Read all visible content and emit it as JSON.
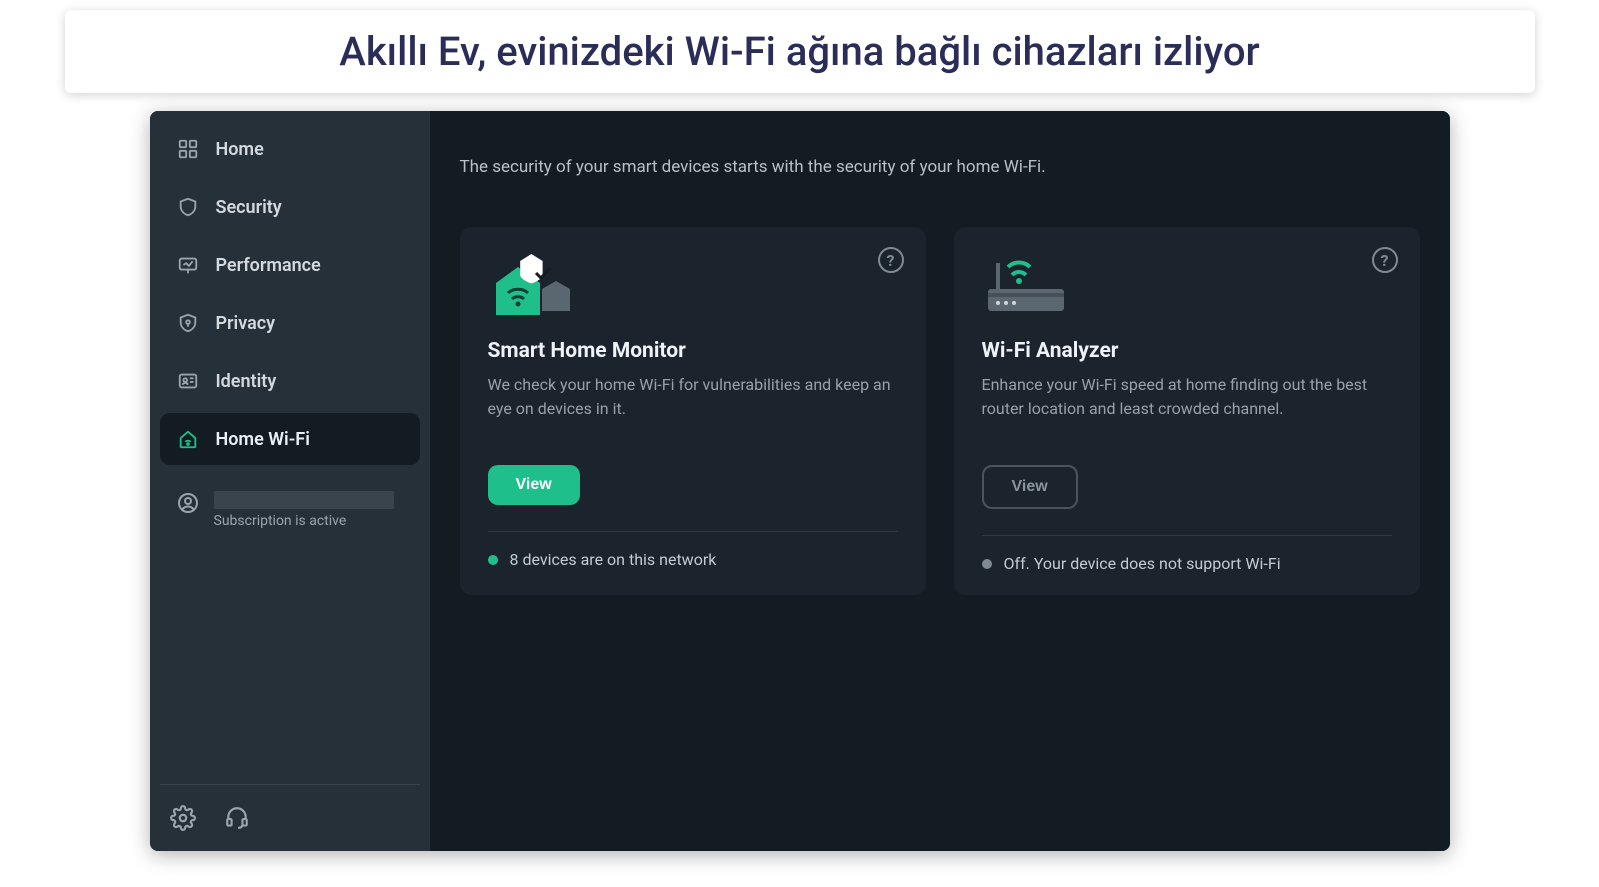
{
  "caption": "Akıllı Ev, evinizdeki Wi-Fi ağına bağlı cihazları izliyor",
  "sidebar": {
    "items": [
      {
        "label": "Home",
        "icon": "home-grid-icon"
      },
      {
        "label": "Security",
        "icon": "shield-icon"
      },
      {
        "label": "Performance",
        "icon": "performance-icon"
      },
      {
        "label": "Privacy",
        "icon": "privacy-shield-icon"
      },
      {
        "label": "Identity",
        "icon": "id-card-icon"
      },
      {
        "label": "Home Wi-Fi",
        "icon": "house-wifi-icon"
      }
    ],
    "active_index": 5,
    "account": {
      "subscription_status": "Subscription is active"
    },
    "footer": {
      "settings_icon": "gear-icon",
      "support_icon": "headset-icon"
    }
  },
  "main": {
    "page_title_partial": "Home Wi-Fi",
    "subtitle": "The security of your smart devices starts with the security of your home Wi-Fi.",
    "cards": [
      {
        "title": "Smart Home Monitor",
        "description": "We check your home Wi-Fi for vulnerabilities and keep an eye on devices in it.",
        "button_label": "View",
        "button_style": "primary",
        "status_text": "8 devices are on this network",
        "status_color": "green",
        "icon": "smart-home-icon",
        "help_label": "?"
      },
      {
        "title": "Wi-Fi Analyzer",
        "description": "Enhance your Wi-Fi speed at home finding out the best router location and least crowded channel.",
        "button_label": "View",
        "button_style": "ghost",
        "status_text": "Off. Your device does not support Wi-Fi",
        "status_color": "grey",
        "icon": "router-icon",
        "help_label": "?"
      }
    ]
  }
}
